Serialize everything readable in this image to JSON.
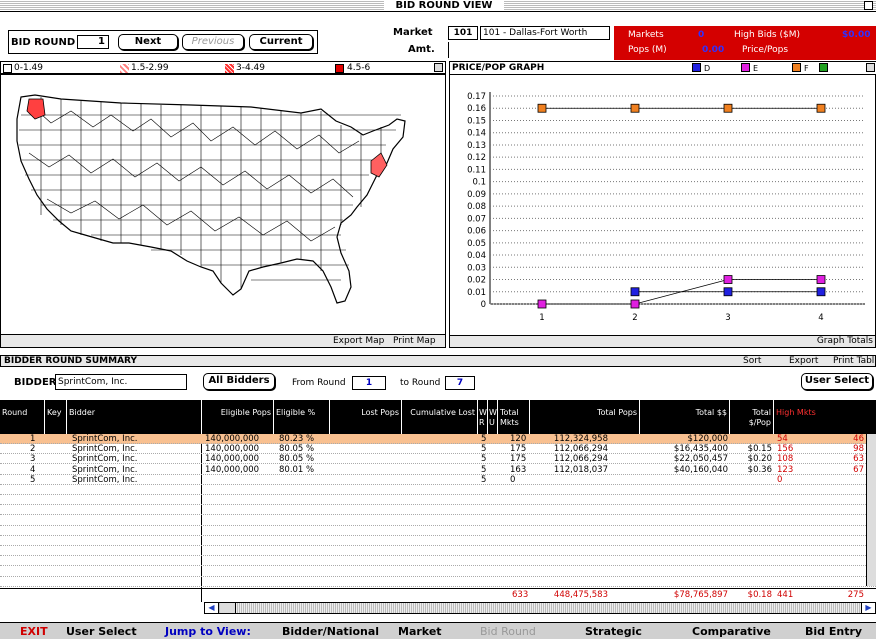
{
  "window": {
    "title": "BID ROUND VIEW"
  },
  "controls": {
    "bid_round_label": "BID ROUND",
    "bid_round_value": "1",
    "next": "Next",
    "previous": "Previous",
    "current": "Current",
    "market_label": "Market",
    "amt_label": "Amt.",
    "market_number": "101",
    "market_name": "101 - Dallas-Fort Worth"
  },
  "stats": {
    "markets_label": "Markets",
    "markets_value": "0",
    "high_bids_label": "High Bids ($M)",
    "high_bids_value": "$0.00",
    "pops_label": "Pops (M)",
    "pops_value": "0.00",
    "price_pops_label": "Price/Pops"
  },
  "legend": [
    {
      "label": "0-1.49",
      "color": "#ffffff"
    },
    {
      "label": "1.5-2.99",
      "color": "#ff8080"
    },
    {
      "label": "3-4.49",
      "color": "#ff3030"
    },
    {
      "label": "4.5-6",
      "color": "#e00000"
    }
  ],
  "map": {
    "export": "Export Map",
    "print": "Print Map"
  },
  "graph": {
    "title": "PRICE/POP GRAPH",
    "legend": [
      {
        "label": "D",
        "color": "#2020e0"
      },
      {
        "label": "E",
        "color": "#e020e0"
      },
      {
        "label": "F",
        "color": "#f08020"
      },
      {
        "label": "",
        "color": "#20a020"
      }
    ],
    "totals": "Graph Totals",
    "yticks": [
      "0.17",
      "0.16",
      "0.15",
      "0.14",
      "0.13",
      "0.12",
      "0.11",
      "0.1",
      "0.09",
      "0.08",
      "0.07",
      "0.06",
      "0.05",
      "0.04",
      "0.03",
      "0.02",
      "0.01",
      "0"
    ],
    "xticks": [
      "1",
      "2",
      "3",
      "4"
    ]
  },
  "chart_data": {
    "type": "line",
    "x": [
      1,
      2,
      3,
      4
    ],
    "ylim": [
      0,
      0.17
    ],
    "series": [
      {
        "name": "F",
        "color": "#f08020",
        "values": [
          0.16,
          0.16,
          0.16,
          0.16
        ]
      },
      {
        "name": "E",
        "color": "#e020e0",
        "values": [
          0,
          0,
          0.02,
          0.02
        ]
      },
      {
        "name": "D",
        "color": "#2020e0",
        "values": [
          null,
          0.01,
          0.01,
          0.01
        ]
      }
    ]
  },
  "summary": {
    "title": "BIDDER ROUND SUMMARY",
    "sort": "Sort",
    "export": "Export",
    "print": "Print Tabl",
    "bidder_label": "BIDDER",
    "bidder_value": "SprintCom, Inc.",
    "all_bidders": "All Bidders",
    "from_round_label": "From Round",
    "from_round": "1",
    "to_round_label": "to Round",
    "to_round": "7",
    "user_select": "User Select"
  },
  "columns": [
    "Round",
    "Key",
    "Bidder",
    "Eligible Pops",
    "Eligible %",
    "Lost Pops",
    "Cumulative Lost",
    "W R",
    "W U",
    "Total Mkts",
    "Total Pops",
    "Total $$",
    "Total $/Pop",
    "High Mkts"
  ],
  "rows": [
    {
      "round": "1",
      "bidder": "SprintCom, Inc.",
      "elig": "140,000,000",
      "pct": "80.23 %",
      "w": "5",
      "mkts": "120",
      "pops": "112,324,958",
      "dollars": "$120,000",
      "perpop": "",
      "high": "54",
      "extra": "46"
    },
    {
      "round": "2",
      "bidder": "SprintCom, Inc.",
      "elig": "140,000,000",
      "pct": "80.05 %",
      "w": "5",
      "mkts": "175",
      "pops": "112,066,294",
      "dollars": "$16,435,400",
      "perpop": "$0.15",
      "high": "156",
      "extra": "98"
    },
    {
      "round": "3",
      "bidder": "SprintCom, Inc.",
      "elig": "140,000,000",
      "pct": "80.05 %",
      "w": "5",
      "mkts": "175",
      "pops": "112,066,294",
      "dollars": "$22,050,457",
      "perpop": "$0.20",
      "high": "108",
      "extra": "63"
    },
    {
      "round": "4",
      "bidder": "SprintCom, Inc.",
      "elig": "140,000,000",
      "pct": "80.01 %",
      "w": "5",
      "mkts": "163",
      "pops": "112,018,037",
      "dollars": "$40,160,040",
      "perpop": "$0.36",
      "high": "123",
      "extra": "67"
    },
    {
      "round": "5",
      "bidder": "SprintCom, Inc.",
      "elig": "",
      "pct": "",
      "w": "5",
      "mkts": "0",
      "pops": "",
      "dollars": "",
      "perpop": "",
      "high": "0",
      "extra": ""
    }
  ],
  "totals": {
    "mkts": "633",
    "pops": "448,475,583",
    "dollars": "$78,765,897",
    "perpop": "$0.18",
    "high": "441",
    "extra": "275"
  },
  "bottom": {
    "exit": "EXIT",
    "user_select": "User Select",
    "jump": "Jump to View:",
    "bidder_national": "Bidder/National",
    "market": "Market",
    "bid_round": "Bid Round",
    "strategic": "Strategic",
    "comparative": "Comparative",
    "bid_entry": "Bid Entry"
  }
}
